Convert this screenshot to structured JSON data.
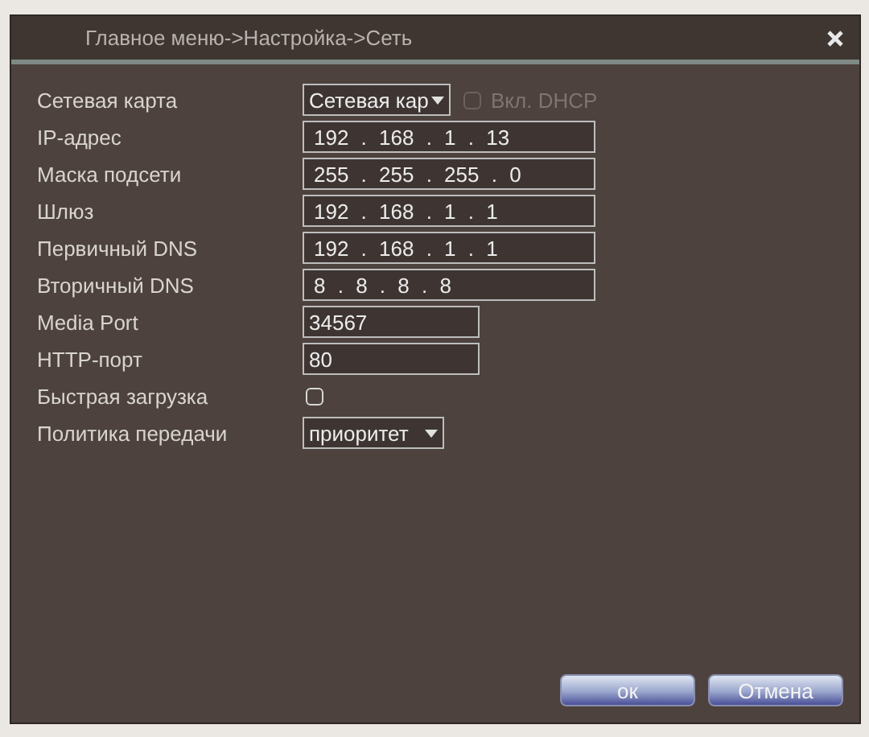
{
  "window": {
    "title": "Главное меню->Настройка->Сеть"
  },
  "rows": [
    {
      "kind": "select",
      "label": "Сетевая карта",
      "value": "Сетевая кар",
      "dhcp": {
        "label": "Вкл. DHCP",
        "checked": false,
        "disabled": true
      }
    },
    {
      "kind": "ip",
      "label": "IP-адрес",
      "value": "192 . 168 . 1 . 13"
    },
    {
      "kind": "ip",
      "label": "Маска подсети",
      "value": "255 . 255 . 255 . 0"
    },
    {
      "kind": "ip",
      "label": "Шлюз",
      "value": "192 . 168 . 1 . 1"
    },
    {
      "kind": "ip",
      "label": "Первичный DNS",
      "value": "192 . 168 . 1 . 1"
    },
    {
      "kind": "ip",
      "label": "Вторичный DNS",
      "value": "8 . 8 . 8 . 8"
    },
    {
      "kind": "text",
      "label": "Media Port",
      "value": "34567"
    },
    {
      "kind": "text",
      "label": "HTTP-порт",
      "value": "80"
    },
    {
      "kind": "checkbox",
      "label": "Быстрая загрузка",
      "checked": false
    },
    {
      "kind": "select",
      "label": "Политика передачи",
      "value": "приоритет"
    }
  ],
  "buttons": [
    "ок",
    "Отмена"
  ]
}
